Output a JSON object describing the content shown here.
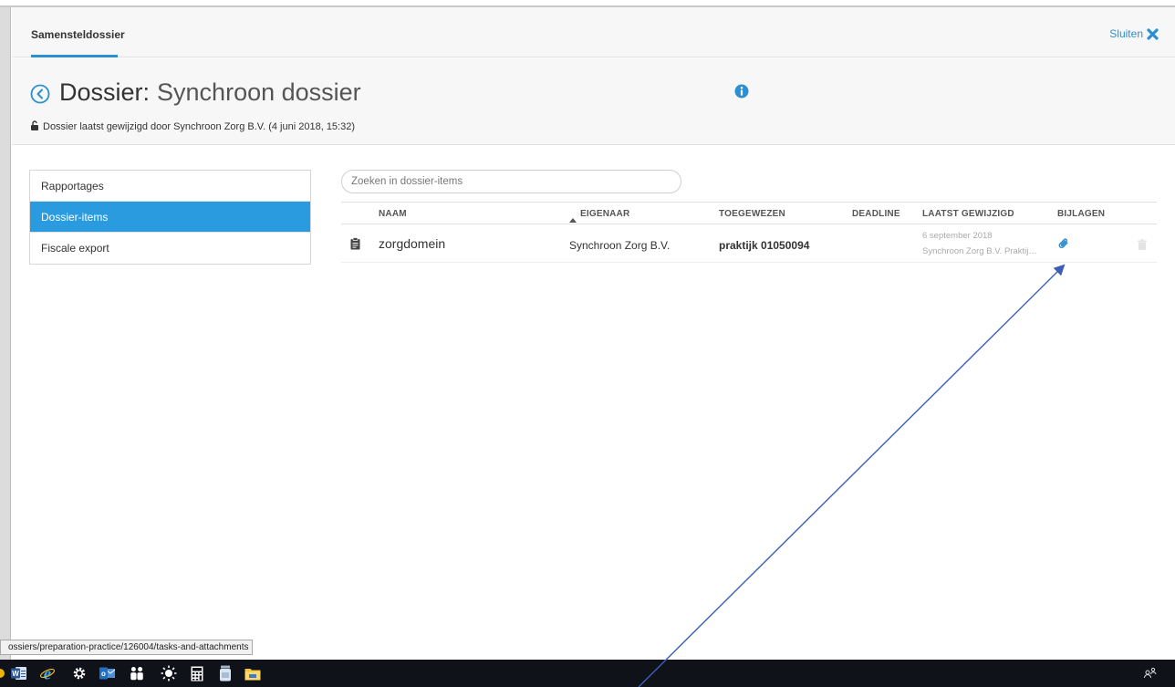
{
  "header": {
    "tab_label": "Samensteldossier",
    "close_label": "Sluiten"
  },
  "title_area": {
    "label": "Dossier:",
    "subject": "Synchroon dossier",
    "modified_text": "Dossier laatst gewijzigd door Synchroon Zorg B.V. (4 juni 2018, 15:32)"
  },
  "nav": {
    "items": [
      {
        "label": "Rapportages",
        "active": false
      },
      {
        "label": "Dossier-items",
        "active": true
      },
      {
        "label": "Fiscale export",
        "active": false
      }
    ]
  },
  "search": {
    "placeholder": "Zoeken in dossier-items"
  },
  "table": {
    "columns": [
      "NAAM",
      "EIGENAAR",
      "TOEGEWEZEN",
      "DEADLINE",
      "LAATST GEWIJZIGD",
      "BIJLAGEN"
    ],
    "rows": [
      {
        "name": "zorgdomein",
        "owner": "Synchroon Zorg B.V.",
        "assigned": "praktijk 01050094",
        "deadline": "",
        "modified_date": "6 september 2018",
        "modified_by": "Synchroon Zorg B.V. Praktijk ..."
      }
    ]
  },
  "status_url": "ossiers/preparation-practice/126004/tasks-and-attachments",
  "colors": {
    "accent": "#2b9be0",
    "link": "#2b8fd1",
    "taskbar": "#10121a",
    "annotation_arrow": "#3a5fb5"
  },
  "taskbar": {
    "icons": [
      "word-icon",
      "internet-explorer-icon",
      "settings-icon",
      "outlook-icon",
      "people-icon",
      "brightness-icon",
      "calculator-icon",
      "jar-icon",
      "file-explorer-icon"
    ]
  }
}
